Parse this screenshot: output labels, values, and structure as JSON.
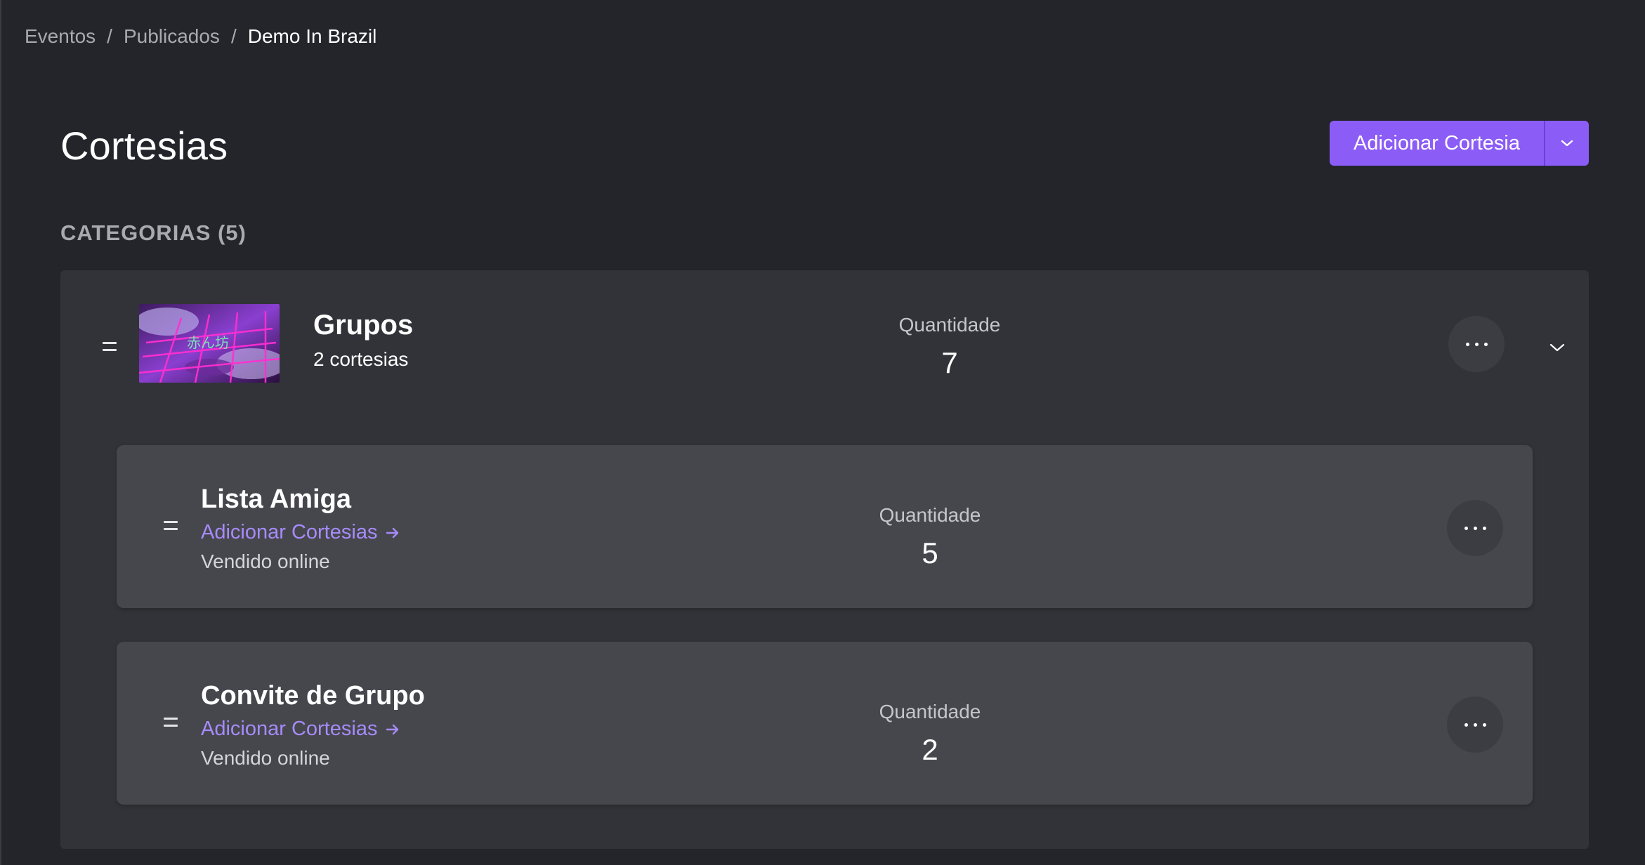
{
  "breadcrumb": {
    "items": [
      "Eventos",
      "Publicados",
      "Demo In Brazil"
    ],
    "separator": "/"
  },
  "header": {
    "title": "Cortesias",
    "add_button_label": "Adicionar Cortesia",
    "dropdown_icon": "chevron-down-icon"
  },
  "section": {
    "label": "CATEGORIAS (5)"
  },
  "category": {
    "name": "Grupos",
    "subtitle": "2 cortesias",
    "quantity_label": "Quantidade",
    "quantity": "7",
    "more_icon": "more-horizontal-icon",
    "collapse_icon": "chevron-down-icon",
    "thumbnail_text": "赤ん坊",
    "items": [
      {
        "title": "Lista Amiga",
        "link_label": "Adicionar Cortesias",
        "link_icon": "arrow-right-icon",
        "meta": "Vendido online",
        "quantity_label": "Quantidade",
        "quantity": "5"
      },
      {
        "title": "Convite de Grupo",
        "link_label": "Adicionar Cortesias",
        "link_icon": "arrow-right-icon",
        "meta": "Vendido online",
        "quantity_label": "Quantidade",
        "quantity": "2"
      }
    ]
  },
  "colors": {
    "background": "#23252b",
    "card": "#323338",
    "sub_card": "#46474d",
    "accent": "#8b5cf6",
    "link": "#a78bfa"
  }
}
